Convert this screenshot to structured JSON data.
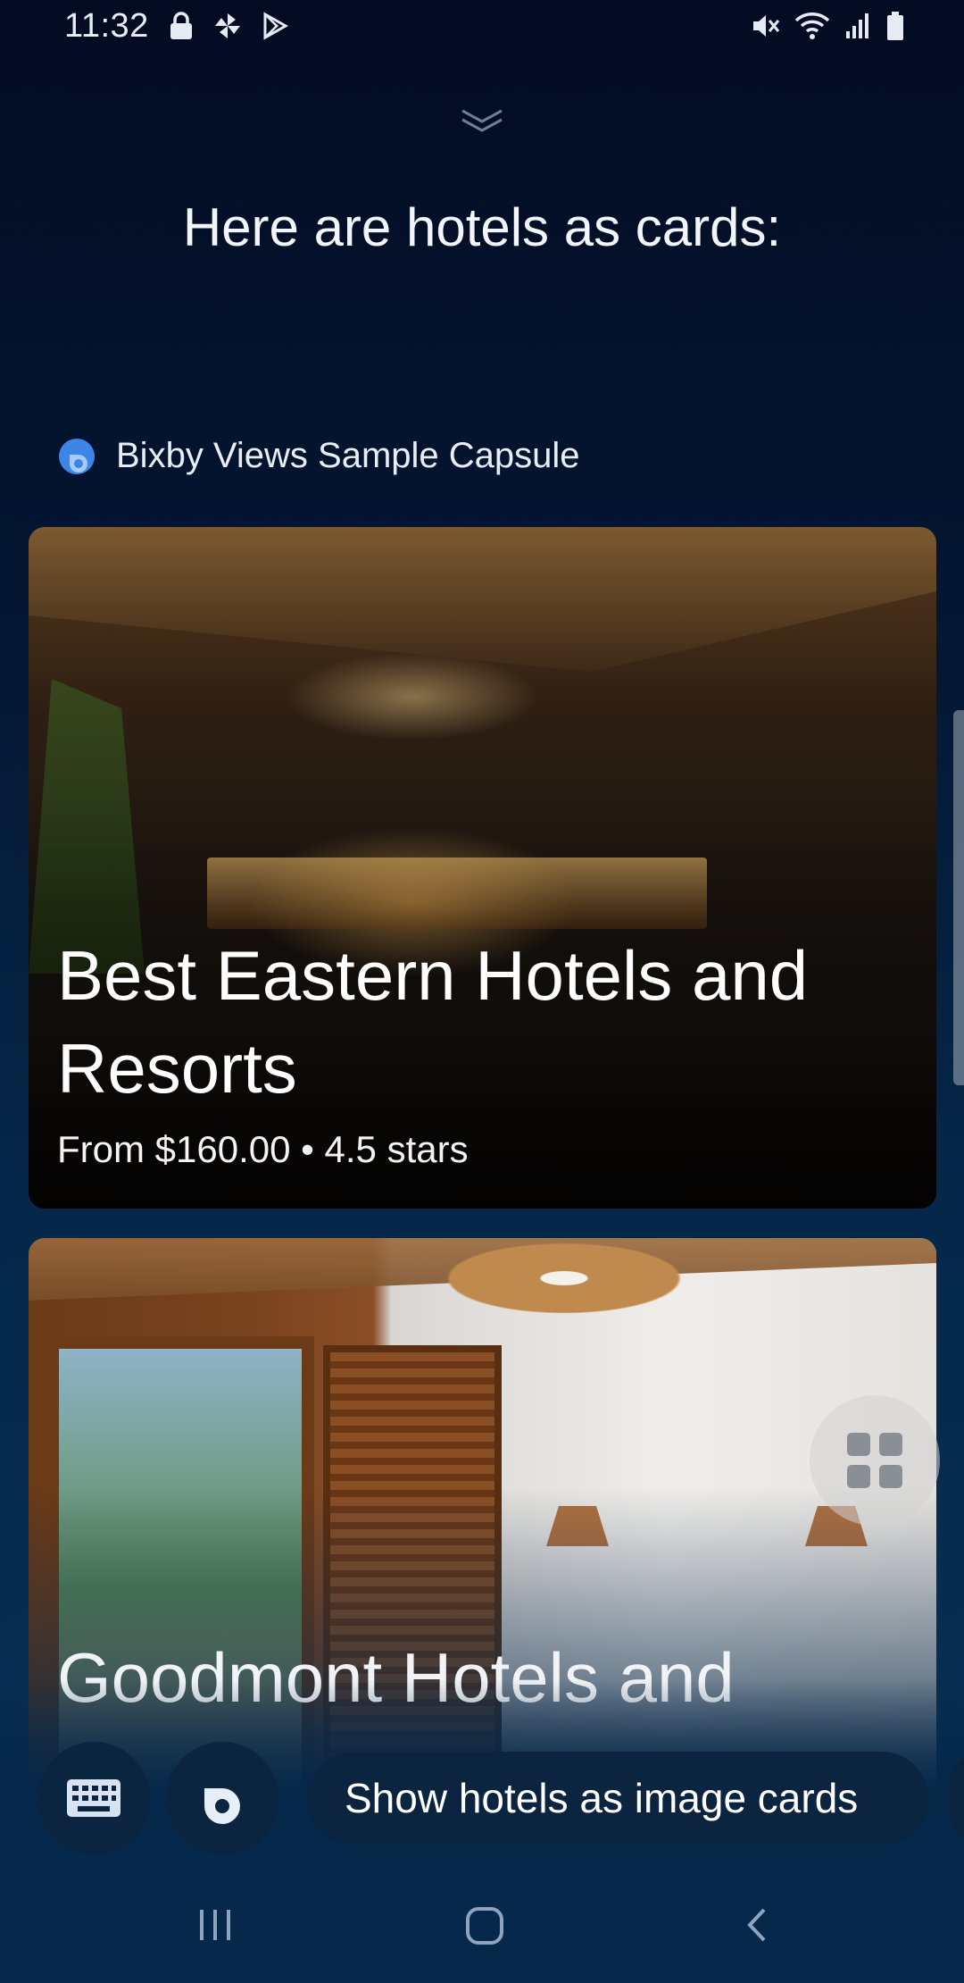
{
  "status_bar": {
    "time": "11:32",
    "left_icons": [
      "lock-icon",
      "pinwheel-icon",
      "play-store-icon"
    ],
    "right_icons": [
      "mute-icon",
      "wifi-icon",
      "signal-icon",
      "battery-icon"
    ]
  },
  "headline": "Here are hotels as cards:",
  "capsule": {
    "name": "Bixby Views Sample Capsule",
    "icon": "bixby-capsule-icon"
  },
  "cards": [
    {
      "title": "Best Eastern Hotels and Resorts",
      "subtitle": "From $160.00 • 4.5 stars"
    },
    {
      "title": "Goodmont Hotels and"
    }
  ],
  "bottom_bar": {
    "suggestion": "Show hotels as image cards",
    "keyboard_icon": "keyboard-icon",
    "bixby_icon": "bixby-icon"
  },
  "nav": [
    "recents-icon",
    "home-icon",
    "back-icon"
  ],
  "colors": {
    "background_top": "#030b22",
    "background_bottom": "#06284a",
    "chip": "#0b2440"
  }
}
